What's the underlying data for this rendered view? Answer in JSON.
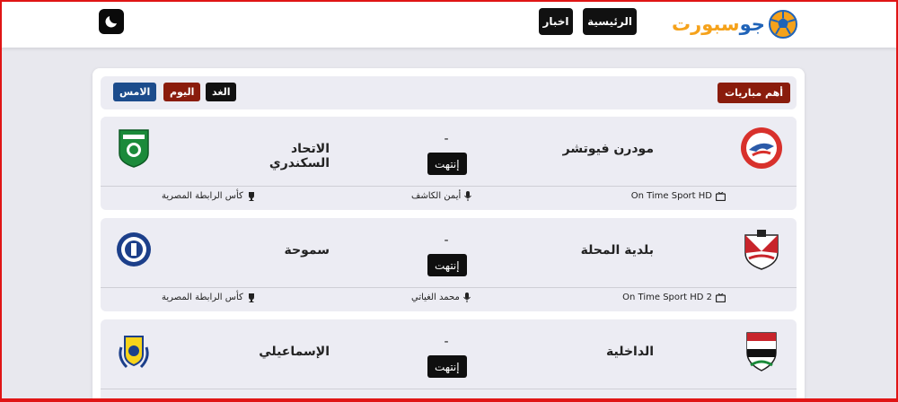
{
  "header": {
    "logo_text_orange": "سبورت",
    "logo_text_blue": "جو",
    "nav": {
      "home": "الرئيسية",
      "news": "اخبار"
    },
    "theme_icon": "moon-icon"
  },
  "panel": {
    "title": "أهم مباريات",
    "days": {
      "tomorrow": "الغد",
      "today": "اليوم",
      "yesterday": "الامس"
    }
  },
  "matches": [
    {
      "home": "مودرن فيوتشر",
      "away": "الاتحاد السكندري",
      "score": "-",
      "status": "إنتهت",
      "channel": "On Time Sport HD",
      "referee": "أيمن الكاشف",
      "competition": "كأس الرابطة المصرية"
    },
    {
      "home": "بلدية المحلة",
      "away": "سموحة",
      "score": "-",
      "status": "إنتهت",
      "channel": "On Time Sport HD 2",
      "referee": "محمد الغياتي",
      "competition": "كأس الرابطة المصرية"
    },
    {
      "home": "الداخلية",
      "away": "الإسماعيلي",
      "score": "-",
      "status": "إنتهت"
    }
  ],
  "colors": {
    "title_badge": "#8a1c0c",
    "yesterday_btn": "#1c4c8c",
    "logo_orange": "#f5a21b",
    "logo_blue": "#1f63b8"
  }
}
